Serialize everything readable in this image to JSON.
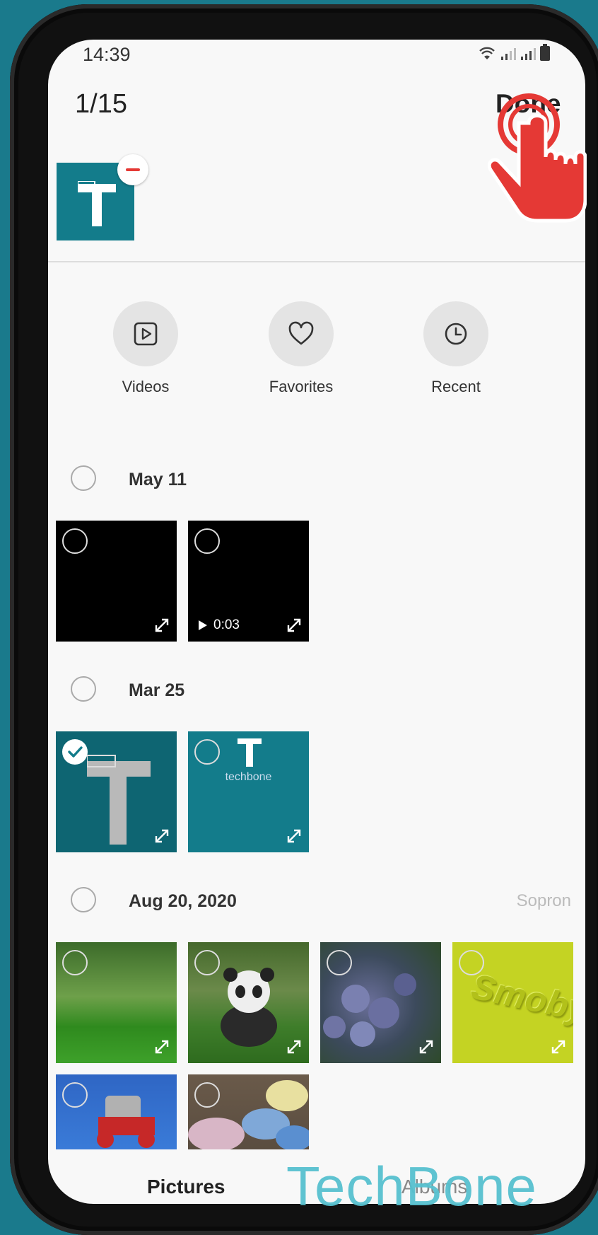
{
  "status_bar": {
    "time": "14:39"
  },
  "header": {
    "count": "1/15",
    "done_label": "Done"
  },
  "categories": [
    {
      "label": "Videos",
      "icon": "play-square-icon"
    },
    {
      "label": "Favorites",
      "icon": "heart-icon"
    },
    {
      "label": "Recent",
      "icon": "clock-icon"
    }
  ],
  "sections": [
    {
      "date": "May 11",
      "location": "",
      "items": [
        {
          "kind": "photo"
        },
        {
          "kind": "video",
          "duration": "0:03"
        }
      ]
    },
    {
      "date": "Mar 25",
      "location": "",
      "items": [
        {
          "kind": "photo",
          "selected": true
        },
        {
          "kind": "photo",
          "caption": "techbone"
        }
      ]
    },
    {
      "date": "Aug 20, 2020",
      "location": "Sopron",
      "items": [
        {
          "kind": "photo"
        },
        {
          "kind": "photo"
        },
        {
          "kind": "photo"
        },
        {
          "kind": "photo",
          "caption": "Smoby"
        },
        {
          "kind": "photo"
        },
        {
          "kind": "photo"
        }
      ]
    }
  ],
  "bottom_tabs": {
    "pictures": "Pictures",
    "albums": "Albums"
  },
  "watermark": "TechBone",
  "colors": {
    "accent_teal": "#137c8b",
    "background": "#1a7a8c",
    "tap_red": "#e53935"
  }
}
